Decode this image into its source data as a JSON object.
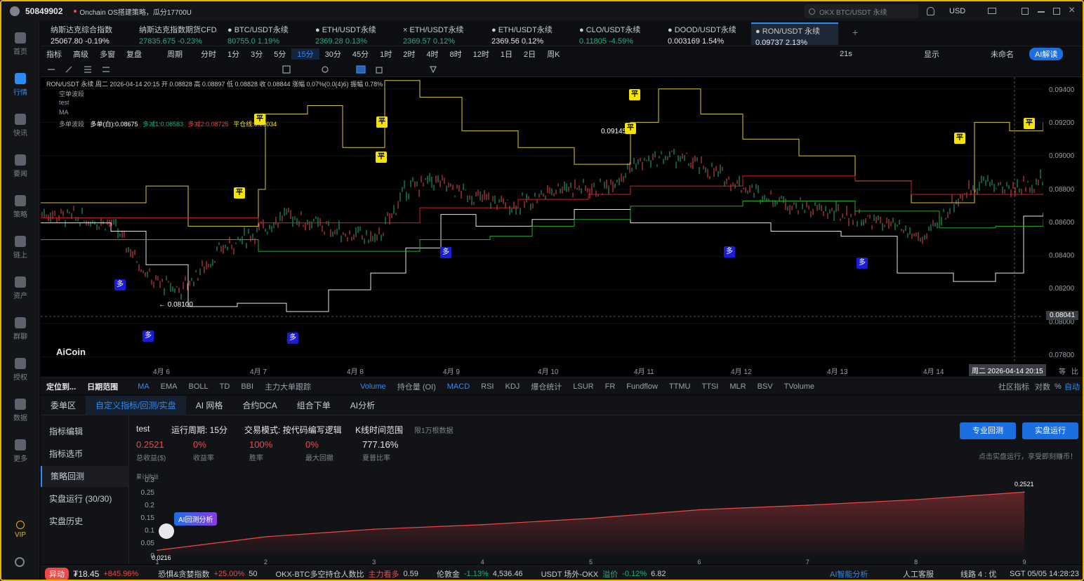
{
  "titlebar": {
    "account_id": "50849902",
    "notice": "Onchain OS搭建策略，瓜分17700U",
    "search_placeholder": "OKX BTC/USDT 永续",
    "currency": "USD"
  },
  "nav": [
    {
      "label": "首页",
      "icon": "home-icon"
    },
    {
      "label": "行情",
      "icon": "chart-bar-icon"
    },
    {
      "label": "快讯",
      "icon": "news-icon"
    },
    {
      "label": "要闻",
      "icon": "article-icon"
    },
    {
      "label": "策略",
      "icon": "robot-icon"
    },
    {
      "label": "链上",
      "icon": "chain-icon"
    },
    {
      "label": "资产",
      "icon": "wallet-icon"
    },
    {
      "label": "群聊",
      "icon": "chat-icon"
    },
    {
      "label": "授权",
      "icon": "key-icon"
    },
    {
      "label": "数据",
      "icon": "data-icon"
    },
    {
      "label": "更多",
      "icon": "grid-icon"
    },
    {
      "label": "VIP",
      "icon": "vip-icon"
    }
  ],
  "tickers": [
    {
      "name": "纳斯达克综合指数",
      "price": "25067.80",
      "change": "-0.19%",
      "dir": "wh"
    },
    {
      "name": "纳斯达克指数期货CFD",
      "price": "27835.675",
      "change": "-0.23%",
      "dir": "up"
    },
    {
      "name": "BTC/USDT永续",
      "price": "80755.0",
      "change": "1.19%",
      "dir": "up"
    },
    {
      "name": "ETH/USDT永续",
      "price": "2369.28",
      "change": "0.13%",
      "dir": "up"
    },
    {
      "name": "ETH/USDT永续",
      "price": "2369.57",
      "change": "0.12%",
      "dir": "up"
    },
    {
      "name": "ETH/USDT永续",
      "price": "2369.56",
      "change": "0.12%",
      "dir": "wh"
    },
    {
      "name": "CLO/USDT永续",
      "price": "0.11805",
      "change": "-4.59%",
      "dir": "up"
    },
    {
      "name": "DOOD/USDT永续",
      "price": "0.003169",
      "change": "1.54%",
      "dir": "wh"
    },
    {
      "name": "RON/USDT 永续",
      "price": "0.09737",
      "change": "2.13%",
      "dir": "wh"
    }
  ],
  "periods": {
    "items": [
      "指标",
      "高级",
      "多窗",
      "复盘",
      "周期",
      "分时",
      "1分",
      "3分",
      "5分",
      "15分",
      "30分",
      "45分",
      "1时",
      "2时",
      "4时",
      "8时",
      "12时",
      "1日",
      "2日",
      "周K"
    ],
    "selected": "15分",
    "right": [
      "21s",
      "显示",
      "未命名",
      "AI解读"
    ]
  },
  "chart_info": {
    "line1": "RON/USDT 永续 周二 2026-04-14 20:15 开 0.08828 高 0.08897 低 0.08828 收 0.08844 涨幅 0.07%(0.0(4)6) 振幅 0.78%",
    "line2": "空单波段",
    "line3": "test",
    "line4": "MA",
    "line5_label": "多单波段",
    "line5_a": "多单(白):0.08675",
    "line5_b": "多减1:0.08583",
    "line5_c": "多减2:0.08725",
    "line5_d": "平仓线:0.09034",
    "low_label": "← 0.08100",
    "high_label": "0.09145",
    "price_tag": "0.08041",
    "time_tag": "周二 2026-04-14 20:15",
    "watermark": "AiCoin",
    "ping": "平",
    "duo": "多"
  },
  "yaxis": [
    "0.09400",
    "0.09200",
    "0.09000",
    "0.08800",
    "0.08600",
    "0.08400",
    "0.08200",
    "0.08000",
    "0.07800"
  ],
  "xaxis": [
    "4月 6",
    "4月 7",
    "4月 8",
    "4月 9",
    "4月 10",
    "4月 11",
    "4月 12",
    "4月 13",
    "4月 14"
  ],
  "xaxis_right": [
    "等",
    "比"
  ],
  "indicators": {
    "left": [
      "定位到...",
      "日期范围"
    ],
    "main": [
      "MA",
      "EMA",
      "BOLL",
      "TD",
      "BBI",
      "主力大单跟踪"
    ],
    "sub": [
      "Volume",
      "持仓量 (OI)",
      "MACD",
      "RSI",
      "KDJ",
      "爆仓统计",
      "LSUR",
      "FR",
      "Fundflow",
      "TTMU",
      "TTSI",
      "MLR",
      "BSV",
      "TVolume"
    ],
    "right": [
      "社区指标",
      "对数",
      "%",
      "自动"
    ]
  },
  "bottom": {
    "tabs": [
      "委单区",
      "自定义指标/回测/实盘",
      "AI 网格",
      "合约DCA",
      "组合下单",
      "AI分析"
    ],
    "selected_tab": "自定义指标/回测/实盘",
    "menu": [
      "指标编辑",
      "指标选币",
      "策略回测",
      "实盘运行 (30/30)",
      "实盘历史"
    ],
    "selected_menu": "策略回测",
    "controls": {
      "strategy": "test",
      "period": "运行周期: 15分",
      "mode": "交易模式: 按代码编写逻辑",
      "range": "K线时间范围",
      "limit": "限1万根数据"
    },
    "stats": [
      {
        "value": "0.2521",
        "label": "总收益($)"
      },
      {
        "value": "0%",
        "label": "收益率"
      },
      {
        "value": "100%",
        "label": "胜率"
      },
      {
        "value": "0%",
        "label": "最大回撤"
      },
      {
        "value": "777.16%",
        "label": "夏普比率"
      }
    ],
    "buttons": {
      "pro": "专业回测",
      "live": "实盘运行"
    },
    "hint": "点击实盘运行，享受即刻赚币！",
    "ai_tag": "AI回测分析",
    "ylabel": "累计收益"
  },
  "chart_data": {
    "type": "area",
    "ylabel": "累计收益",
    "y_ticks": [
      0,
      0.05,
      0.1,
      0.15,
      0.2,
      0.25,
      0.3
    ],
    "x_ticks": [
      1,
      2,
      3,
      4,
      5,
      6,
      7,
      8,
      9
    ],
    "ylim": [
      0,
      0.3
    ],
    "start_label": "0.0216",
    "end_label": "0.2521",
    "x": [
      1,
      2,
      3,
      4,
      5,
      6,
      7,
      8,
      9
    ],
    "values": [
      0.0216,
      0.075,
      0.105,
      0.123,
      0.148,
      0.182,
      0.2,
      0.222,
      0.2521
    ]
  },
  "statusbar": {
    "tag": "异动",
    "price": "₮18.45",
    "pct": "+845.96%",
    "fear_label": "恐惧&贪婪指数",
    "fear_pct": "+25.00%",
    "fear_val": "50",
    "okx_label": "OKX-BTC多空持仓人数比",
    "okx_tag": "主力看多",
    "okx_val": "0.59",
    "gold_label": "伦敦金",
    "gold_pct": "-1.13%",
    "gold_val": "4,536.46",
    "usdt_label": "USDT 场外-OKX",
    "usdt_tag": "溢价",
    "usdt_pct": "-0.12%",
    "usdt_val": "6.82",
    "ai": "AI智能分析",
    "service": "人工客服",
    "line": "线路 4 : 优",
    "time": "SGT 05/05 14:28:23"
  },
  "colors": {
    "accent": "#2d8cf0",
    "up": "#19b57e",
    "down": "#f04848",
    "ping": "#f5e400",
    "duo": "#1c1cd8"
  }
}
